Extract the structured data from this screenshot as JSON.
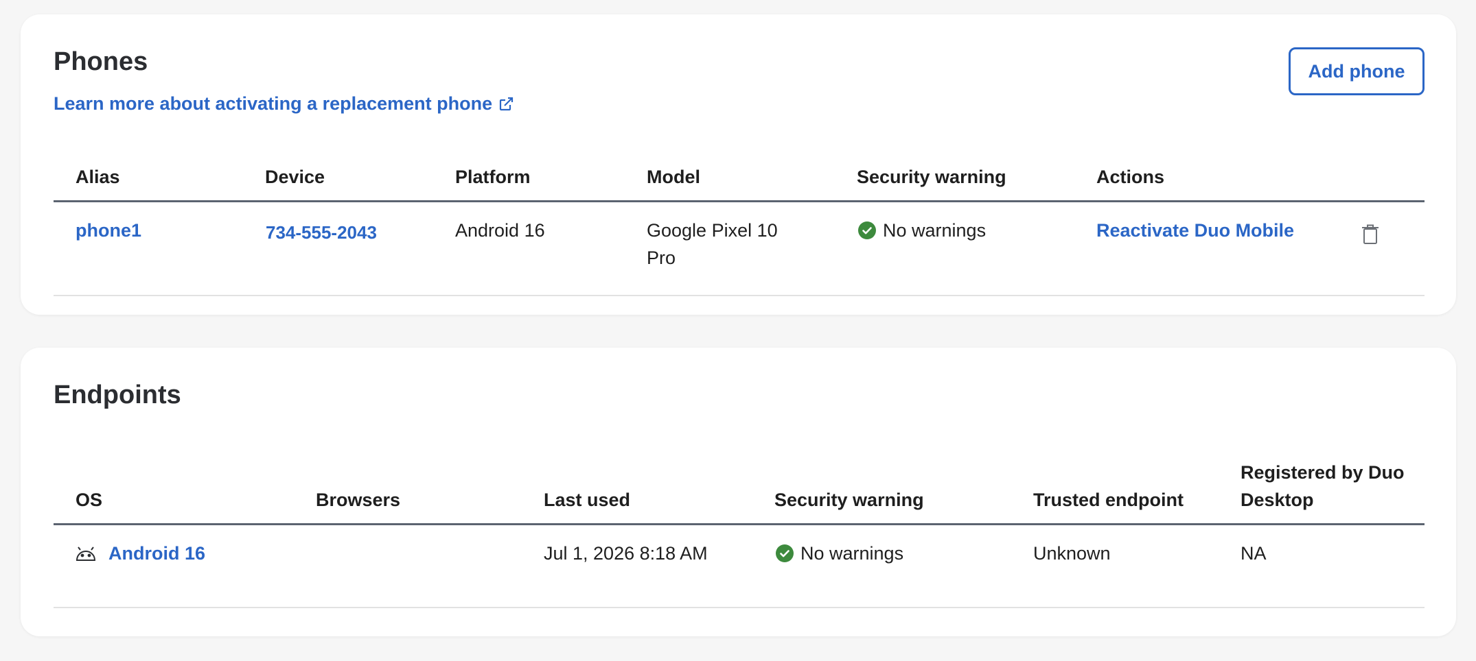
{
  "phones": {
    "title": "Phones",
    "learn_more": "Learn more about activating a replacement phone",
    "add_phone": "Add phone",
    "columns": [
      "Alias",
      "Device",
      "Platform",
      "Model",
      "Security warning",
      "Actions"
    ],
    "rows": [
      {
        "alias": "phone1",
        "device": "734-555-2043",
        "platform": "Android 16",
        "model": "Google Pixel 10 Pro",
        "security_warning": "No warnings",
        "action": "Reactivate Duo Mobile"
      }
    ]
  },
  "endpoints": {
    "title": "Endpoints",
    "columns": [
      "OS",
      "Browsers",
      "Last used",
      "Security warning",
      "Trusted endpoint",
      "Registered by Duo Desktop"
    ],
    "rows": [
      {
        "os": "Android 16",
        "browsers": "",
        "last_used": "Jul 1, 2026 8:18 AM",
        "security_warning": "No warnings",
        "trusted_endpoint": "Unknown",
        "registered_by_duo_desktop": "NA"
      }
    ]
  },
  "colors": {
    "link": "#2b66c6",
    "ok_green": "#3d8a3d",
    "header_rule": "#5b6370"
  },
  "icons": {
    "external_link": "external-link-icon",
    "check": "check-circle-icon",
    "trash": "trash-icon",
    "android": "android-icon"
  }
}
